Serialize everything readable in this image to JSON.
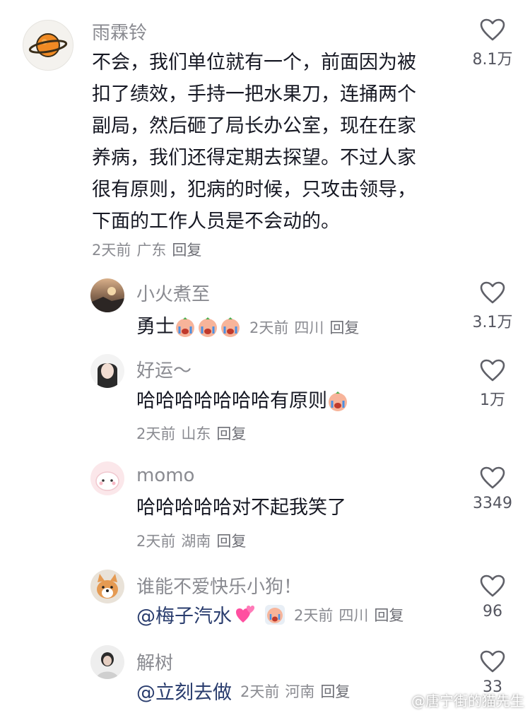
{
  "comments": [
    {
      "username": "雨霖铃",
      "text_lines": [
        "不会，我们单位就有一个，前面因为被",
        "扣了绩效，手持一把水果刀，连捅两个",
        "副局，然后砸了局长办公室，现在在家",
        "养病，我们还得定期去探望。不过人家",
        "很有原则，犯病的时候，只攻击领导，",
        "下面的工作人员是不会动的。"
      ],
      "time": "2天前",
      "location": "广东",
      "reply": "回复",
      "likes": "8.1万"
    },
    {
      "username": "小火煮至",
      "text": "勇士",
      "time": "2天前",
      "location": "四川",
      "reply": "回复",
      "likes": "3.1万"
    },
    {
      "username": "好运～",
      "text": "哈哈哈哈哈哈哈有原则",
      "time": "2天前",
      "location": "山东",
      "reply": "回复",
      "likes": "1万"
    },
    {
      "username": "momo",
      "text": "哈哈哈哈哈对不起我笑了",
      "time": "2天前",
      "location": "湖南",
      "reply": "回复",
      "likes": "3349"
    },
    {
      "username": "谁能不爱快乐小狗！",
      "mention": "@梅子汽水",
      "time": "2天前",
      "location": "四川",
      "reply": "回复",
      "likes": "96"
    },
    {
      "username": "解树",
      "mention": "@立刻去做",
      "time": "2天前",
      "location": "河南",
      "reply": "回复",
      "likes": "33"
    }
  ],
  "watermark": "@唐宁街的猫先生",
  "colors": {
    "username": "#8a8b91",
    "text": "#161823",
    "mention": "#2a3d6e",
    "heart": "#5f6068"
  },
  "icons": [
    "heart-outline-icon",
    "crying-face-emoji",
    "hearts-emoji"
  ]
}
